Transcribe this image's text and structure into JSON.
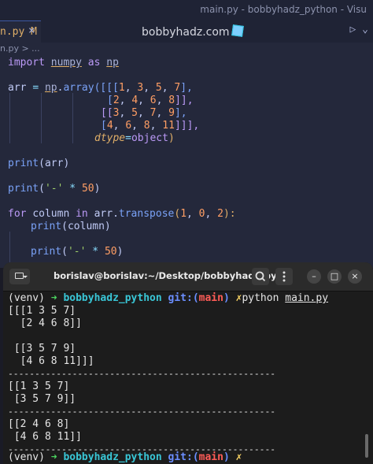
{
  "window": {
    "title": "main.py - bobbyhadz_python - Visu"
  },
  "editor": {
    "tab_label": "n.py",
    "tab_modified": "M",
    "center_title": "bobbyhadz.com",
    "breadcrumb": "n.py > ...",
    "code": {
      "l1": {
        "kw": "import",
        "mod": "numpy",
        "as": "as",
        "alias": "np"
      },
      "l3": {
        "name": "arr",
        "eq": "=",
        "mod": "np",
        "dot": ".",
        "fn": "array",
        "open": "([[[",
        "n1": "1",
        "n2": "3",
        "n3": "5",
        "n4": "7",
        "close": "],",
        "c1": ", ",
        "c2": ", ",
        "c3": ", "
      },
      "l4": {
        "open": "[",
        "n1": "2",
        "n2": "4",
        "n3": "6",
        "n4": "8",
        "close": "]],",
        "c": ", "
      },
      "l5": {
        "open": "[[",
        "n1": "3",
        "n2": "5",
        "n3": "7",
        "n4": "9",
        "close": "],",
        "c": ", "
      },
      "l6": {
        "open": "[",
        "n1": "4",
        "n2": "6",
        "n3": "8",
        "n4": "11",
        "close": "]]],",
        "c": ", "
      },
      "l7": {
        "param": "dtype",
        "eq": "=",
        "val": "object",
        "close": ")"
      },
      "l9": {
        "fn": "print",
        "arg": "(arr)"
      },
      "l11": {
        "fn": "print",
        "open": "(",
        "str": "'-'",
        "op": "*",
        "num": "50",
        "close": ")"
      },
      "l13": {
        "kw": "for",
        "var": "column",
        "in": "in",
        "obj": "arr",
        "fn": "transpose",
        "open": "(",
        "n1": "1",
        "n2": "0",
        "n3": "2",
        "close": "):"
      },
      "l14": {
        "fn": "print",
        "arg": "(column)"
      },
      "l16": {
        "fn": "print",
        "open": "(",
        "str": "'-'",
        "op": "*",
        "num": "50",
        "close": ")"
      }
    }
  },
  "terminal": {
    "title": "borislav@borislav:~/Desktop/bobbyhadz_pyt...",
    "search_icon": "search-icon",
    "menu_icon": "kebab-menu-icon",
    "minimize": "–",
    "maximize": "□",
    "close": "×",
    "prompt": {
      "venv": "(venv)",
      "arrow": "➜",
      "dir": "bobbyhadz_python",
      "git": "git:(",
      "branch": "main",
      "gitclose": ")",
      "x": "✗"
    },
    "command": {
      "cmd": "python",
      "file": "main.py"
    },
    "output": [
      "[[[1 3 5 7]",
      "  [2 4 6 8]]",
      "",
      " [[3 5 7 9]",
      "  [4 6 8 11]]]",
      "--------------------------------------------------",
      "[[1 3 5 7]",
      " [3 5 7 9]]",
      "--------------------------------------------------",
      "[[2 4 6 8]",
      " [4 6 8 11]]",
      "--------------------------------------------------"
    ]
  }
}
